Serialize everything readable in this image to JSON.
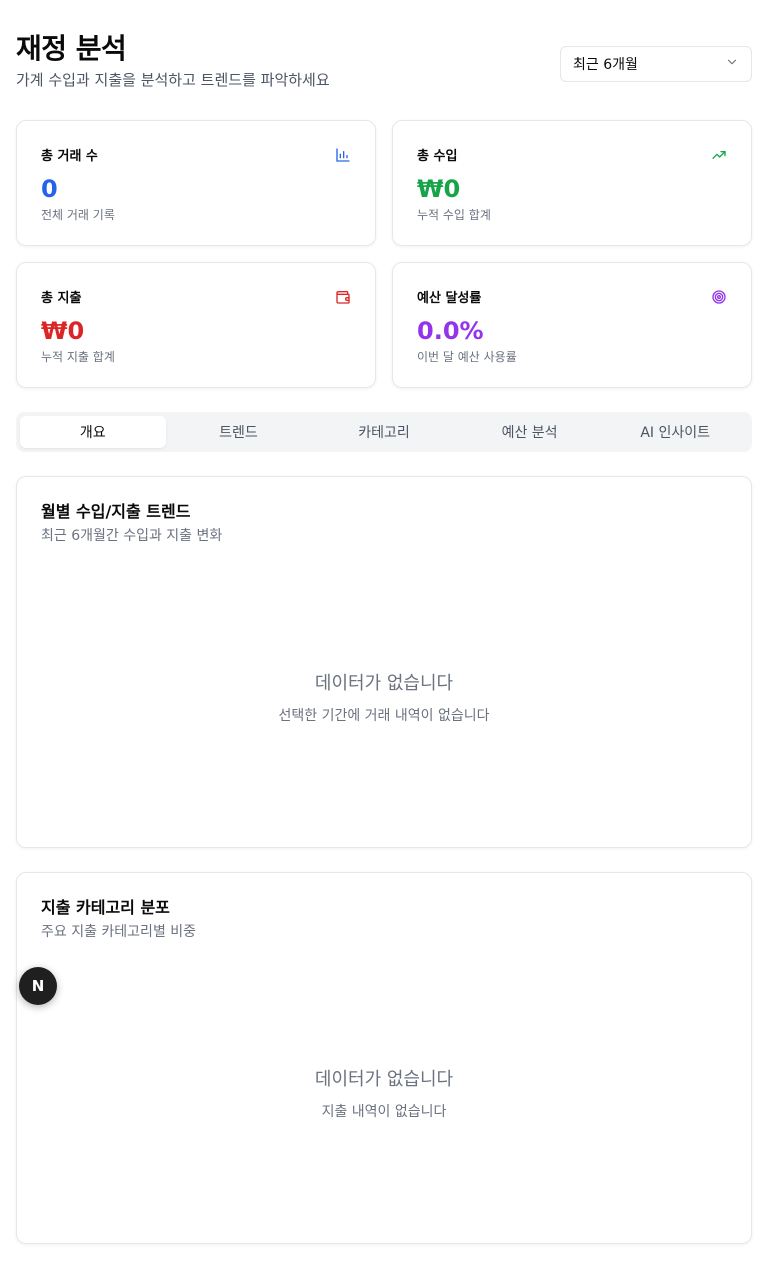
{
  "header": {
    "title": "재정 분석",
    "subtitle": "가계 수입과 지출을 분석하고 트렌드를 파악하세요"
  },
  "period_select": {
    "value": "최근 6개월"
  },
  "stats": [
    {
      "label": "총 거래 수",
      "value": "0",
      "note": "전체 거래 기록",
      "icon": "bar-chart-icon",
      "color": "#2563eb"
    },
    {
      "label": "총 수입",
      "value": "₩0",
      "note": "누적 수입 합계",
      "icon": "trending-up-icon",
      "color": "#16a34a"
    },
    {
      "label": "총 지출",
      "value": "₩0",
      "note": "누적 지출 합계",
      "icon": "wallet-icon",
      "color": "#dc2626"
    },
    {
      "label": "예산 달성률",
      "value": "0.0%",
      "note": "이번 달 예산 사용률",
      "icon": "target-icon",
      "color": "#9333ea"
    }
  ],
  "tabs": [
    {
      "label": "개요",
      "active": true
    },
    {
      "label": "트렌드"
    },
    {
      "label": "카테고리"
    },
    {
      "label": "예산 분석"
    },
    {
      "label": "AI 인사이트"
    }
  ],
  "panels": [
    {
      "title": "월별 수입/지출 트렌드",
      "description": "최근 6개월간 수입과 지출 변화",
      "empty_title": "데이터가 없습니다",
      "empty_subtitle": "선택한 기간에 거래 내역이 없습니다"
    },
    {
      "title": "지출 카테고리 분포",
      "description": "주요 지출 카테고리별 비중",
      "empty_title": "데이터가 없습니다",
      "empty_subtitle": "지출 내역이 없습니다"
    }
  ],
  "fab": {
    "label": "N",
    "icon": "next-logo-icon"
  }
}
